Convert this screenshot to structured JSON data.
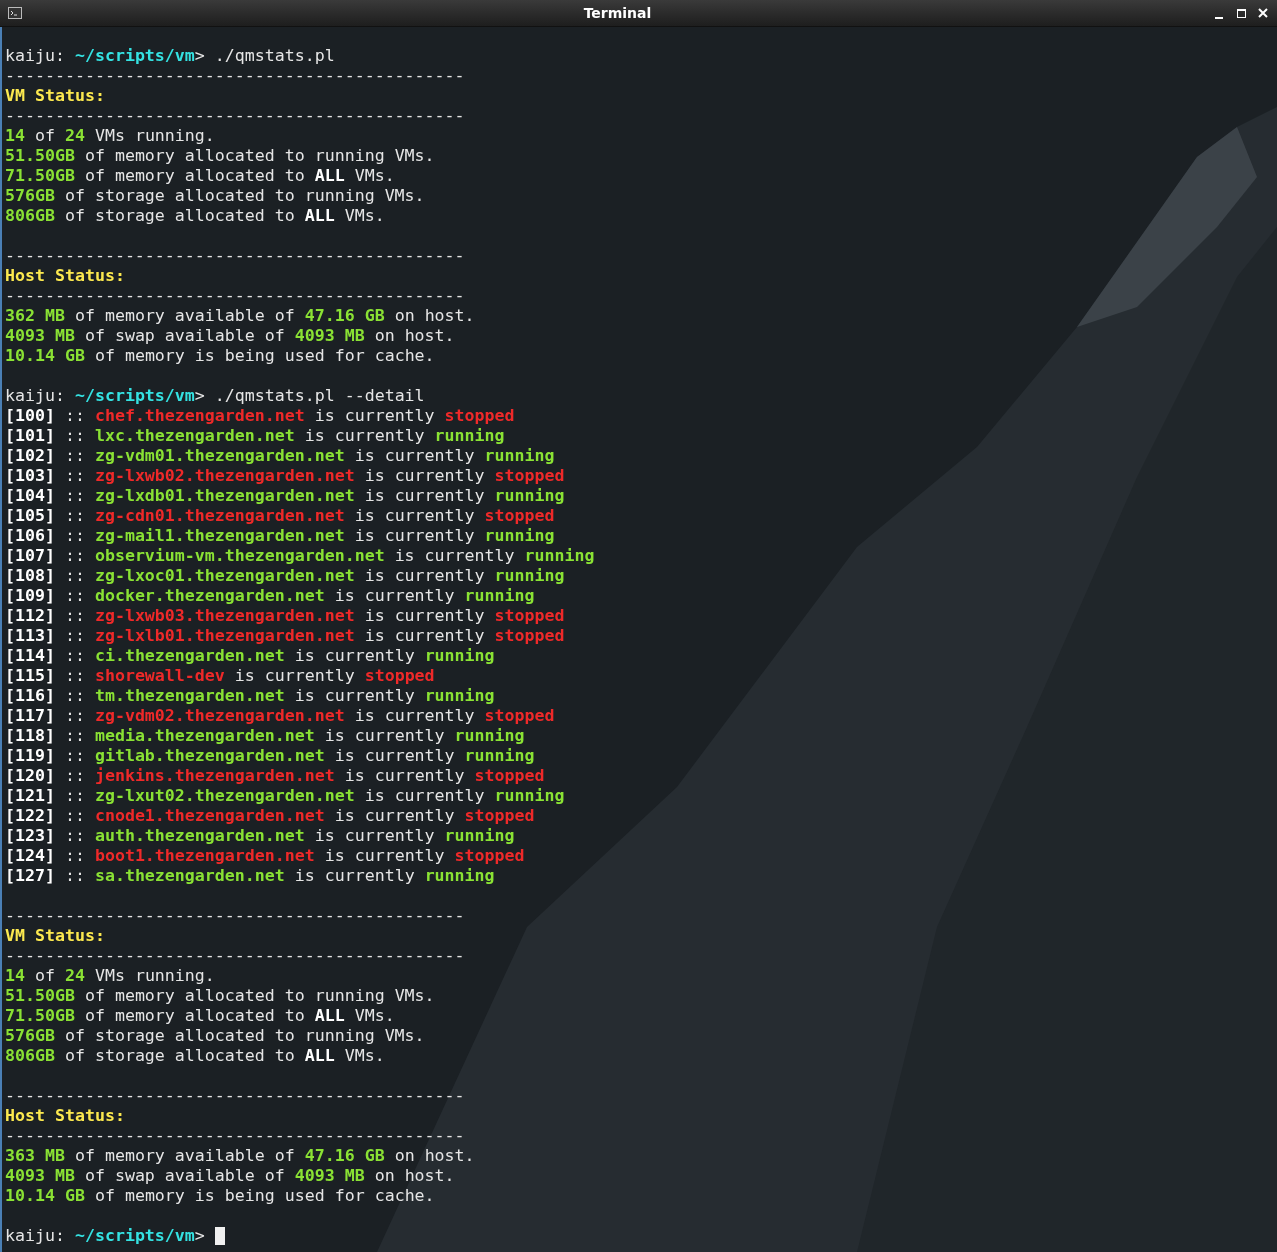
{
  "window": {
    "title": "Terminal"
  },
  "lines": [
    {
      "kind": "text",
      "segments": [
        {
          "text": "kaiju: ",
          "kind": "plain"
        },
        {
          "text": "~/scripts/vm",
          "kind": "path"
        },
        {
          "text": "> ./qmstats.pl",
          "kind": "plain"
        }
      ]
    },
    {
      "kind": "text",
      "segments": [
        {
          "text": "----------------------------------------------",
          "kind": "plain"
        }
      ]
    },
    {
      "kind": "text",
      "segments": [
        {
          "text": "VM Status:",
          "kind": "heading"
        }
      ]
    },
    {
      "kind": "text",
      "segments": [
        {
          "text": "----------------------------------------------",
          "kind": "plain"
        }
      ]
    },
    {
      "kind": "text",
      "segments": [
        {
          "text": "14",
          "kind": "num"
        },
        {
          "text": " of ",
          "kind": "plain"
        },
        {
          "text": "24",
          "kind": "num"
        },
        {
          "text": " VMs running.",
          "kind": "plain"
        }
      ]
    },
    {
      "kind": "text",
      "segments": [
        {
          "text": "51.50GB",
          "kind": "num"
        },
        {
          "text": " of memory allocated to running VMs.",
          "kind": "plain"
        }
      ]
    },
    {
      "kind": "text",
      "segments": [
        {
          "text": "71.50GB",
          "kind": "num"
        },
        {
          "text": " of memory allocated to ",
          "kind": "plain"
        },
        {
          "text": "ALL",
          "kind": "strong"
        },
        {
          "text": " VMs.",
          "kind": "plain"
        }
      ]
    },
    {
      "kind": "text",
      "segments": [
        {
          "text": "576GB",
          "kind": "num"
        },
        {
          "text": " of storage allocated to running VMs.",
          "kind": "plain"
        }
      ]
    },
    {
      "kind": "text",
      "segments": [
        {
          "text": "806GB",
          "kind": "num"
        },
        {
          "text": " of storage allocated to ",
          "kind": "plain"
        },
        {
          "text": "ALL",
          "kind": "strong"
        },
        {
          "text": " VMs.",
          "kind": "plain"
        }
      ]
    },
    {
      "kind": "blank"
    },
    {
      "kind": "text",
      "segments": [
        {
          "text": "----------------------------------------------",
          "kind": "plain"
        }
      ]
    },
    {
      "kind": "text",
      "segments": [
        {
          "text": "Host Status:",
          "kind": "heading"
        }
      ]
    },
    {
      "kind": "text",
      "segments": [
        {
          "text": "----------------------------------------------",
          "kind": "plain"
        }
      ]
    },
    {
      "kind": "text",
      "segments": [
        {
          "text": "362 MB",
          "kind": "num"
        },
        {
          "text": " of memory available of ",
          "kind": "plain"
        },
        {
          "text": "47.16 GB",
          "kind": "num"
        },
        {
          "text": " on host.",
          "kind": "plain"
        }
      ]
    },
    {
      "kind": "text",
      "segments": [
        {
          "text": "4093 MB",
          "kind": "num"
        },
        {
          "text": " of swap available of ",
          "kind": "plain"
        },
        {
          "text": "4093 MB",
          "kind": "num"
        },
        {
          "text": " on host.",
          "kind": "plain"
        }
      ]
    },
    {
      "kind": "text",
      "segments": [
        {
          "text": "10.14 GB",
          "kind": "num"
        },
        {
          "text": " of memory is being used for cache.",
          "kind": "plain"
        }
      ]
    },
    {
      "kind": "blank"
    },
    {
      "kind": "text",
      "segments": [
        {
          "text": "kaiju: ",
          "kind": "plain"
        },
        {
          "text": "~/scripts/vm",
          "kind": "path"
        },
        {
          "text": "> ./qmstats.pl --detail",
          "kind": "plain"
        }
      ]
    },
    {
      "kind": "text",
      "segments": [
        {
          "text": "[100]",
          "kind": "id"
        },
        {
          "text": " :: ",
          "kind": "plain"
        },
        {
          "text": "chef.thezengarden.net",
          "kind": "down"
        },
        {
          "text": " is currently ",
          "kind": "plain"
        },
        {
          "text": "stopped",
          "kind": "down"
        }
      ]
    },
    {
      "kind": "text",
      "segments": [
        {
          "text": "[101]",
          "kind": "id"
        },
        {
          "text": " :: ",
          "kind": "plain"
        },
        {
          "text": "lxc.thezengarden.net",
          "kind": "up"
        },
        {
          "text": " is currently ",
          "kind": "plain"
        },
        {
          "text": "running",
          "kind": "up"
        }
      ]
    },
    {
      "kind": "text",
      "segments": [
        {
          "text": "[102]",
          "kind": "id"
        },
        {
          "text": " :: ",
          "kind": "plain"
        },
        {
          "text": "zg-vdm01.thezengarden.net",
          "kind": "up"
        },
        {
          "text": " is currently ",
          "kind": "plain"
        },
        {
          "text": "running",
          "kind": "up"
        }
      ]
    },
    {
      "kind": "text",
      "segments": [
        {
          "text": "[103]",
          "kind": "id"
        },
        {
          "text": " :: ",
          "kind": "plain"
        },
        {
          "text": "zg-lxwb02.thezengarden.net",
          "kind": "down"
        },
        {
          "text": " is currently ",
          "kind": "plain"
        },
        {
          "text": "stopped",
          "kind": "down"
        }
      ]
    },
    {
      "kind": "text",
      "segments": [
        {
          "text": "[104]",
          "kind": "id"
        },
        {
          "text": " :: ",
          "kind": "plain"
        },
        {
          "text": "zg-lxdb01.thezengarden.net",
          "kind": "up"
        },
        {
          "text": " is currently ",
          "kind": "plain"
        },
        {
          "text": "running",
          "kind": "up"
        }
      ]
    },
    {
      "kind": "text",
      "segments": [
        {
          "text": "[105]",
          "kind": "id"
        },
        {
          "text": " :: ",
          "kind": "plain"
        },
        {
          "text": "zg-cdn01.thezengarden.net",
          "kind": "down"
        },
        {
          "text": " is currently ",
          "kind": "plain"
        },
        {
          "text": "stopped",
          "kind": "down"
        }
      ]
    },
    {
      "kind": "text",
      "segments": [
        {
          "text": "[106]",
          "kind": "id"
        },
        {
          "text": " :: ",
          "kind": "plain"
        },
        {
          "text": "zg-mail1.thezengarden.net",
          "kind": "up"
        },
        {
          "text": " is currently ",
          "kind": "plain"
        },
        {
          "text": "running",
          "kind": "up"
        }
      ]
    },
    {
      "kind": "text",
      "segments": [
        {
          "text": "[107]",
          "kind": "id"
        },
        {
          "text": " :: ",
          "kind": "plain"
        },
        {
          "text": "observium-vm.thezengarden.net",
          "kind": "up"
        },
        {
          "text": " is currently ",
          "kind": "plain"
        },
        {
          "text": "running",
          "kind": "up"
        }
      ]
    },
    {
      "kind": "text",
      "segments": [
        {
          "text": "[108]",
          "kind": "id"
        },
        {
          "text": " :: ",
          "kind": "plain"
        },
        {
          "text": "zg-lxoc01.thezengarden.net",
          "kind": "up"
        },
        {
          "text": " is currently ",
          "kind": "plain"
        },
        {
          "text": "running",
          "kind": "up"
        }
      ]
    },
    {
      "kind": "text",
      "segments": [
        {
          "text": "[109]",
          "kind": "id"
        },
        {
          "text": " :: ",
          "kind": "plain"
        },
        {
          "text": "docker.thezengarden.net",
          "kind": "up"
        },
        {
          "text": " is currently ",
          "kind": "plain"
        },
        {
          "text": "running",
          "kind": "up"
        }
      ]
    },
    {
      "kind": "text",
      "segments": [
        {
          "text": "[112]",
          "kind": "id"
        },
        {
          "text": " :: ",
          "kind": "plain"
        },
        {
          "text": "zg-lxwb03.thezengarden.net",
          "kind": "down"
        },
        {
          "text": " is currently ",
          "kind": "plain"
        },
        {
          "text": "stopped",
          "kind": "down"
        }
      ]
    },
    {
      "kind": "text",
      "segments": [
        {
          "text": "[113]",
          "kind": "id"
        },
        {
          "text": " :: ",
          "kind": "plain"
        },
        {
          "text": "zg-lxlb01.thezengarden.net",
          "kind": "down"
        },
        {
          "text": " is currently ",
          "kind": "plain"
        },
        {
          "text": "stopped",
          "kind": "down"
        }
      ]
    },
    {
      "kind": "text",
      "segments": [
        {
          "text": "[114]",
          "kind": "id"
        },
        {
          "text": " :: ",
          "kind": "plain"
        },
        {
          "text": "ci.thezengarden.net",
          "kind": "up"
        },
        {
          "text": " is currently ",
          "kind": "plain"
        },
        {
          "text": "running",
          "kind": "up"
        }
      ]
    },
    {
      "kind": "text",
      "segments": [
        {
          "text": "[115]",
          "kind": "id"
        },
        {
          "text": " :: ",
          "kind": "plain"
        },
        {
          "text": "shorewall-dev",
          "kind": "down"
        },
        {
          "text": " is currently ",
          "kind": "plain"
        },
        {
          "text": "stopped",
          "kind": "down"
        }
      ]
    },
    {
      "kind": "text",
      "segments": [
        {
          "text": "[116]",
          "kind": "id"
        },
        {
          "text": " :: ",
          "kind": "plain"
        },
        {
          "text": "tm.thezengarden.net",
          "kind": "up"
        },
        {
          "text": " is currently ",
          "kind": "plain"
        },
        {
          "text": "running",
          "kind": "up"
        }
      ]
    },
    {
      "kind": "text",
      "segments": [
        {
          "text": "[117]",
          "kind": "id"
        },
        {
          "text": " :: ",
          "kind": "plain"
        },
        {
          "text": "zg-vdm02.thezengarden.net",
          "kind": "down"
        },
        {
          "text": " is currently ",
          "kind": "plain"
        },
        {
          "text": "stopped",
          "kind": "down"
        }
      ]
    },
    {
      "kind": "text",
      "segments": [
        {
          "text": "[118]",
          "kind": "id"
        },
        {
          "text": " :: ",
          "kind": "plain"
        },
        {
          "text": "media.thezengarden.net",
          "kind": "up"
        },
        {
          "text": " is currently ",
          "kind": "plain"
        },
        {
          "text": "running",
          "kind": "up"
        }
      ]
    },
    {
      "kind": "text",
      "segments": [
        {
          "text": "[119]",
          "kind": "id"
        },
        {
          "text": " :: ",
          "kind": "plain"
        },
        {
          "text": "gitlab.thezengarden.net",
          "kind": "up"
        },
        {
          "text": " is currently ",
          "kind": "plain"
        },
        {
          "text": "running",
          "kind": "up"
        }
      ]
    },
    {
      "kind": "text",
      "segments": [
        {
          "text": "[120]",
          "kind": "id"
        },
        {
          "text": " :: ",
          "kind": "plain"
        },
        {
          "text": "jenkins.thezengarden.net",
          "kind": "down"
        },
        {
          "text": " is currently ",
          "kind": "plain"
        },
        {
          "text": "stopped",
          "kind": "down"
        }
      ]
    },
    {
      "kind": "text",
      "segments": [
        {
          "text": "[121]",
          "kind": "id"
        },
        {
          "text": " :: ",
          "kind": "plain"
        },
        {
          "text": "zg-lxut02.thezengarden.net",
          "kind": "up"
        },
        {
          "text": " is currently ",
          "kind": "plain"
        },
        {
          "text": "running",
          "kind": "up"
        }
      ]
    },
    {
      "kind": "text",
      "segments": [
        {
          "text": "[122]",
          "kind": "id"
        },
        {
          "text": " :: ",
          "kind": "plain"
        },
        {
          "text": "cnode1.thezengarden.net",
          "kind": "down"
        },
        {
          "text": " is currently ",
          "kind": "plain"
        },
        {
          "text": "stopped",
          "kind": "down"
        }
      ]
    },
    {
      "kind": "text",
      "segments": [
        {
          "text": "[123]",
          "kind": "id"
        },
        {
          "text": " :: ",
          "kind": "plain"
        },
        {
          "text": "auth.thezengarden.net",
          "kind": "up"
        },
        {
          "text": " is currently ",
          "kind": "plain"
        },
        {
          "text": "running",
          "kind": "up"
        }
      ]
    },
    {
      "kind": "text",
      "segments": [
        {
          "text": "[124]",
          "kind": "id"
        },
        {
          "text": " :: ",
          "kind": "plain"
        },
        {
          "text": "boot1.thezengarden.net",
          "kind": "down"
        },
        {
          "text": " is currently ",
          "kind": "plain"
        },
        {
          "text": "stopped",
          "kind": "down"
        }
      ]
    },
    {
      "kind": "text",
      "segments": [
        {
          "text": "[127]",
          "kind": "id"
        },
        {
          "text": " :: ",
          "kind": "plain"
        },
        {
          "text": "sa.thezengarden.net",
          "kind": "up"
        },
        {
          "text": " is currently ",
          "kind": "plain"
        },
        {
          "text": "running",
          "kind": "up"
        }
      ]
    },
    {
      "kind": "blank"
    },
    {
      "kind": "text",
      "segments": [
        {
          "text": "----------------------------------------------",
          "kind": "plain"
        }
      ]
    },
    {
      "kind": "text",
      "segments": [
        {
          "text": "VM Status:",
          "kind": "heading"
        }
      ]
    },
    {
      "kind": "text",
      "segments": [
        {
          "text": "----------------------------------------------",
          "kind": "plain"
        }
      ]
    },
    {
      "kind": "text",
      "segments": [
        {
          "text": "14",
          "kind": "num"
        },
        {
          "text": " of ",
          "kind": "plain"
        },
        {
          "text": "24",
          "kind": "num"
        },
        {
          "text": " VMs running.",
          "kind": "plain"
        }
      ]
    },
    {
      "kind": "text",
      "segments": [
        {
          "text": "51.50GB",
          "kind": "num"
        },
        {
          "text": " of memory allocated to running VMs.",
          "kind": "plain"
        }
      ]
    },
    {
      "kind": "text",
      "segments": [
        {
          "text": "71.50GB",
          "kind": "num"
        },
        {
          "text": " of memory allocated to ",
          "kind": "plain"
        },
        {
          "text": "ALL",
          "kind": "strong"
        },
        {
          "text": " VMs.",
          "kind": "plain"
        }
      ]
    },
    {
      "kind": "text",
      "segments": [
        {
          "text": "576GB",
          "kind": "num"
        },
        {
          "text": " of storage allocated to running VMs.",
          "kind": "plain"
        }
      ]
    },
    {
      "kind": "text",
      "segments": [
        {
          "text": "806GB",
          "kind": "num"
        },
        {
          "text": " of storage allocated to ",
          "kind": "plain"
        },
        {
          "text": "ALL",
          "kind": "strong"
        },
        {
          "text": " VMs.",
          "kind": "plain"
        }
      ]
    },
    {
      "kind": "blank"
    },
    {
      "kind": "text",
      "segments": [
        {
          "text": "----------------------------------------------",
          "kind": "plain"
        }
      ]
    },
    {
      "kind": "text",
      "segments": [
        {
          "text": "Host Status:",
          "kind": "heading"
        }
      ]
    },
    {
      "kind": "text",
      "segments": [
        {
          "text": "----------------------------------------------",
          "kind": "plain"
        }
      ]
    },
    {
      "kind": "text",
      "segments": [
        {
          "text": "363 MB",
          "kind": "num"
        },
        {
          "text": " of memory available of ",
          "kind": "plain"
        },
        {
          "text": "47.16 GB",
          "kind": "num"
        },
        {
          "text": " on host.",
          "kind": "plain"
        }
      ]
    },
    {
      "kind": "text",
      "segments": [
        {
          "text": "4093 MB",
          "kind": "num"
        },
        {
          "text": " of swap available of ",
          "kind": "plain"
        },
        {
          "text": "4093 MB",
          "kind": "num"
        },
        {
          "text": " on host.",
          "kind": "plain"
        }
      ]
    },
    {
      "kind": "text",
      "segments": [
        {
          "text": "10.14 GB",
          "kind": "num"
        },
        {
          "text": " of memory is being used for cache.",
          "kind": "plain"
        }
      ]
    },
    {
      "kind": "blank"
    },
    {
      "kind": "prompt",
      "cursor": true,
      "segments": [
        {
          "text": "kaiju: ",
          "kind": "plain"
        },
        {
          "text": "~/scripts/vm",
          "kind": "path"
        },
        {
          "text": "> ",
          "kind": "plain"
        }
      ]
    }
  ]
}
